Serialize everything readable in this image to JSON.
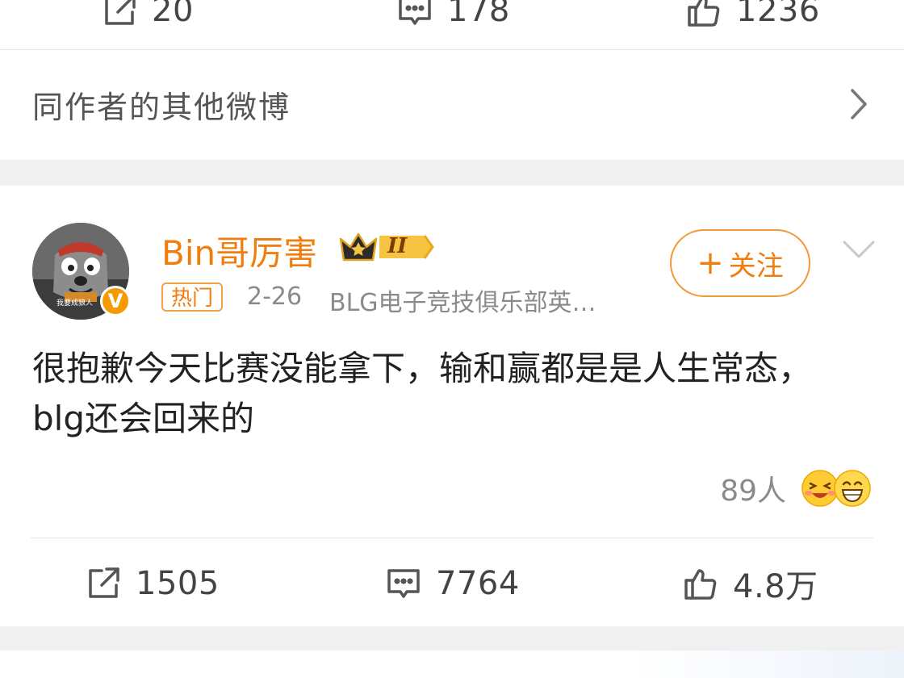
{
  "top_actions": {
    "repost_count": "20",
    "comment_count": "178",
    "like_count": "1236"
  },
  "other_posts": {
    "label": "同作者的其他微博"
  },
  "post": {
    "avatar_caption": "我要成狼人",
    "username": "Bin哥厉害",
    "badge_level": "II",
    "hot_tag": "热门",
    "time": "2-26",
    "source": "BLG电子竞技俱乐部英…",
    "follow_label": "关注",
    "follow_plus": "+",
    "text_line1": "很抱歉今天比赛没能拿下，输和赢都是是人生常态，",
    "text_line2": "blg还会回来的",
    "reaction_count": "89人",
    "actions": {
      "repost_count": "1505",
      "comment_count": "7764",
      "like_count": "4.8万"
    }
  },
  "colors": {
    "accent": "#f27d0f",
    "background": "#f0f0f0",
    "verified": "#f59b00"
  },
  "icons": [
    "repost-icon",
    "comment-icon",
    "like-icon",
    "chevron-right-icon",
    "chevron-down-icon",
    "crown-icon",
    "verified-icon",
    "laugh-emoji-icon",
    "grin-emoji-icon"
  ]
}
